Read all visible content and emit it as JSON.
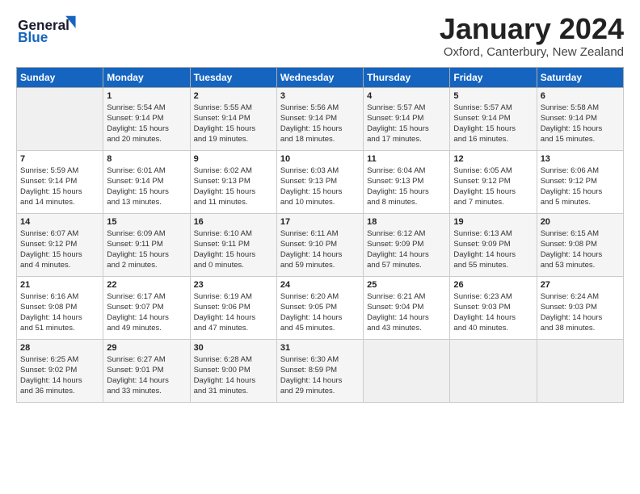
{
  "header": {
    "logo_general": "General",
    "logo_blue": "Blue",
    "month_title": "January 2024",
    "subtitle": "Oxford, Canterbury, New Zealand"
  },
  "days_of_week": [
    "Sunday",
    "Monday",
    "Tuesday",
    "Wednesday",
    "Thursday",
    "Friday",
    "Saturday"
  ],
  "weeks": [
    [
      {
        "date": "",
        "info": ""
      },
      {
        "date": "1",
        "info": "Sunrise: 5:54 AM\nSunset: 9:14 PM\nDaylight: 15 hours\nand 20 minutes."
      },
      {
        "date": "2",
        "info": "Sunrise: 5:55 AM\nSunset: 9:14 PM\nDaylight: 15 hours\nand 19 minutes."
      },
      {
        "date": "3",
        "info": "Sunrise: 5:56 AM\nSunset: 9:14 PM\nDaylight: 15 hours\nand 18 minutes."
      },
      {
        "date": "4",
        "info": "Sunrise: 5:57 AM\nSunset: 9:14 PM\nDaylight: 15 hours\nand 17 minutes."
      },
      {
        "date": "5",
        "info": "Sunrise: 5:57 AM\nSunset: 9:14 PM\nDaylight: 15 hours\nand 16 minutes."
      },
      {
        "date": "6",
        "info": "Sunrise: 5:58 AM\nSunset: 9:14 PM\nDaylight: 15 hours\nand 15 minutes."
      }
    ],
    [
      {
        "date": "7",
        "info": "Sunrise: 5:59 AM\nSunset: 9:14 PM\nDaylight: 15 hours\nand 14 minutes."
      },
      {
        "date": "8",
        "info": "Sunrise: 6:01 AM\nSunset: 9:14 PM\nDaylight: 15 hours\nand 13 minutes."
      },
      {
        "date": "9",
        "info": "Sunrise: 6:02 AM\nSunset: 9:13 PM\nDaylight: 15 hours\nand 11 minutes."
      },
      {
        "date": "10",
        "info": "Sunrise: 6:03 AM\nSunset: 9:13 PM\nDaylight: 15 hours\nand 10 minutes."
      },
      {
        "date": "11",
        "info": "Sunrise: 6:04 AM\nSunset: 9:13 PM\nDaylight: 15 hours\nand 8 minutes."
      },
      {
        "date": "12",
        "info": "Sunrise: 6:05 AM\nSunset: 9:12 PM\nDaylight: 15 hours\nand 7 minutes."
      },
      {
        "date": "13",
        "info": "Sunrise: 6:06 AM\nSunset: 9:12 PM\nDaylight: 15 hours\nand 5 minutes."
      }
    ],
    [
      {
        "date": "14",
        "info": "Sunrise: 6:07 AM\nSunset: 9:12 PM\nDaylight: 15 hours\nand 4 minutes."
      },
      {
        "date": "15",
        "info": "Sunrise: 6:09 AM\nSunset: 9:11 PM\nDaylight: 15 hours\nand 2 minutes."
      },
      {
        "date": "16",
        "info": "Sunrise: 6:10 AM\nSunset: 9:11 PM\nDaylight: 15 hours\nand 0 minutes."
      },
      {
        "date": "17",
        "info": "Sunrise: 6:11 AM\nSunset: 9:10 PM\nDaylight: 14 hours\nand 59 minutes."
      },
      {
        "date": "18",
        "info": "Sunrise: 6:12 AM\nSunset: 9:09 PM\nDaylight: 14 hours\nand 57 minutes."
      },
      {
        "date": "19",
        "info": "Sunrise: 6:13 AM\nSunset: 9:09 PM\nDaylight: 14 hours\nand 55 minutes."
      },
      {
        "date": "20",
        "info": "Sunrise: 6:15 AM\nSunset: 9:08 PM\nDaylight: 14 hours\nand 53 minutes."
      }
    ],
    [
      {
        "date": "21",
        "info": "Sunrise: 6:16 AM\nSunset: 9:08 PM\nDaylight: 14 hours\nand 51 minutes."
      },
      {
        "date": "22",
        "info": "Sunrise: 6:17 AM\nSunset: 9:07 PM\nDaylight: 14 hours\nand 49 minutes."
      },
      {
        "date": "23",
        "info": "Sunrise: 6:19 AM\nSunset: 9:06 PM\nDaylight: 14 hours\nand 47 minutes."
      },
      {
        "date": "24",
        "info": "Sunrise: 6:20 AM\nSunset: 9:05 PM\nDaylight: 14 hours\nand 45 minutes."
      },
      {
        "date": "25",
        "info": "Sunrise: 6:21 AM\nSunset: 9:04 PM\nDaylight: 14 hours\nand 43 minutes."
      },
      {
        "date": "26",
        "info": "Sunrise: 6:23 AM\nSunset: 9:03 PM\nDaylight: 14 hours\nand 40 minutes."
      },
      {
        "date": "27",
        "info": "Sunrise: 6:24 AM\nSunset: 9:03 PM\nDaylight: 14 hours\nand 38 minutes."
      }
    ],
    [
      {
        "date": "28",
        "info": "Sunrise: 6:25 AM\nSunset: 9:02 PM\nDaylight: 14 hours\nand 36 minutes."
      },
      {
        "date": "29",
        "info": "Sunrise: 6:27 AM\nSunset: 9:01 PM\nDaylight: 14 hours\nand 33 minutes."
      },
      {
        "date": "30",
        "info": "Sunrise: 6:28 AM\nSunset: 9:00 PM\nDaylight: 14 hours\nand 31 minutes."
      },
      {
        "date": "31",
        "info": "Sunrise: 6:30 AM\nSunset: 8:59 PM\nDaylight: 14 hours\nand 29 minutes."
      },
      {
        "date": "",
        "info": ""
      },
      {
        "date": "",
        "info": ""
      },
      {
        "date": "",
        "info": ""
      }
    ]
  ]
}
